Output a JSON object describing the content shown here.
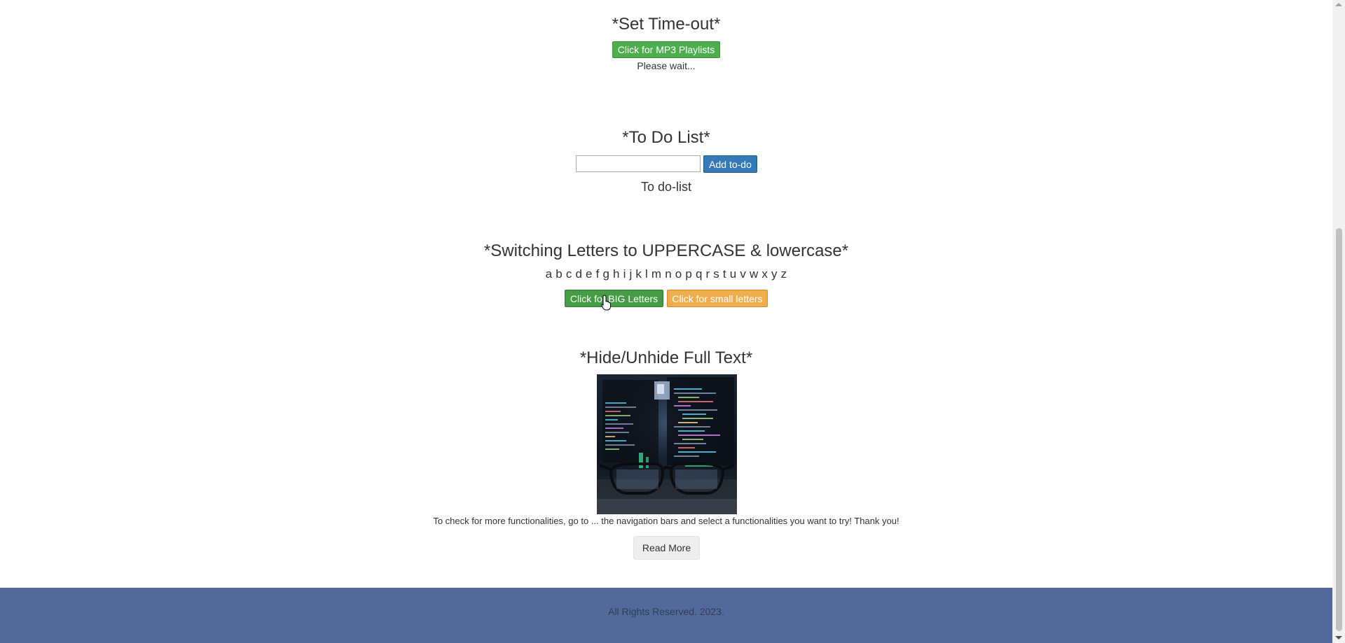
{
  "timeout": {
    "title": "*Set Time-out*",
    "button_label": "Click for MP3 Playlists",
    "status": "Please wait..."
  },
  "todo": {
    "title": "*To Do List*",
    "input_value": "",
    "add_label": "Add to-do",
    "list_heading": "To do-list"
  },
  "letters": {
    "title": "*Switching Letters to UPPERCASE & lowercase*",
    "alphabet": "a b c d e f g h i j k l m n o p q r s t u v w x y z",
    "big_label": "Click for BIG Letters",
    "small_label": "Click for small letters"
  },
  "hide": {
    "title": "*Hide/Unhide Full Text*",
    "text": "To check for more functionalities, go to ... the navigation bars and select a functionalities you want to try! Thank you!",
    "read_more_label": "Read More"
  },
  "footer": {
    "text": "All Rights Reserved. 2023."
  },
  "colors": {
    "green": "#4cae4c",
    "blue": "#337ab7",
    "orange": "#f0ad4e",
    "footer_bg": "#516a9a"
  }
}
